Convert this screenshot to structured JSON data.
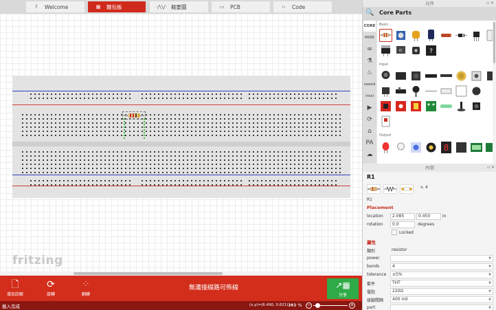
{
  "tabs": [
    {
      "label": "Welcome",
      "icon": "f"
    },
    {
      "label": "麵包板",
      "icon": "▦"
    },
    {
      "label": "概要圖",
      "icon": "-⋀⋁-"
    },
    {
      "label": "PCB",
      "icon": "▭"
    },
    {
      "label": "Code",
      "icon": "‹›"
    }
  ],
  "canvas": {
    "logo": "fritzing"
  },
  "toolbar": {
    "add_note": "增加註解",
    "rotate": "旋轉",
    "flip": "翻轉",
    "routing_status": "無連接線路可佈線",
    "share": "分享"
  },
  "status": {
    "text": "載入完成",
    "coords": "(x,y)=(6.490, 0.621) in",
    "zoom": "149 %",
    "zoom_out": "−",
    "zoom_in": "+"
  },
  "parts_panel": {
    "dock_title": "元件",
    "dock_buttons": "▫ ✕",
    "title": "Core Parts",
    "bins": [
      "CORE",
      "MINE",
      "∞",
      "⚗",
      "♨",
      "seeed",
      "intel",
      "▶",
      "⟳",
      "⌂",
      "PA",
      "☁"
    ],
    "sections": [
      "Basic",
      "Input",
      "Output"
    ]
  },
  "inspector": {
    "dock_title": "內容",
    "dock_buttons": "▫ ✕",
    "title": "R1",
    "version": "v. 4",
    "name": "R1",
    "placement_title": "Placement",
    "location_label": "location",
    "location_x": "2.085",
    "location_y": "0.450",
    "location_unit": "in",
    "rotation_label": "rotation",
    "rotation_value": "0.0",
    "rotation_unit": "degrees",
    "locked_label": "Locked",
    "props_title": "屬性",
    "props": [
      {
        "key": "類別",
        "value": "resistor",
        "kind": "text"
      },
      {
        "key": "power",
        "value": "",
        "kind": "select"
      },
      {
        "key": "bands",
        "value": "4",
        "kind": "select"
      },
      {
        "key": "tolerance",
        "value": "±5%",
        "kind": "select"
      },
      {
        "key": "套件",
        "value": "THT",
        "kind": "select"
      },
      {
        "key": "電阻",
        "value": "220Ω",
        "kind": "select"
      },
      {
        "key": "接腳間隔",
        "value": "400 mil",
        "kind": "select"
      },
      {
        "key": "part",
        "value": "",
        "kind": "select"
      }
    ]
  }
}
